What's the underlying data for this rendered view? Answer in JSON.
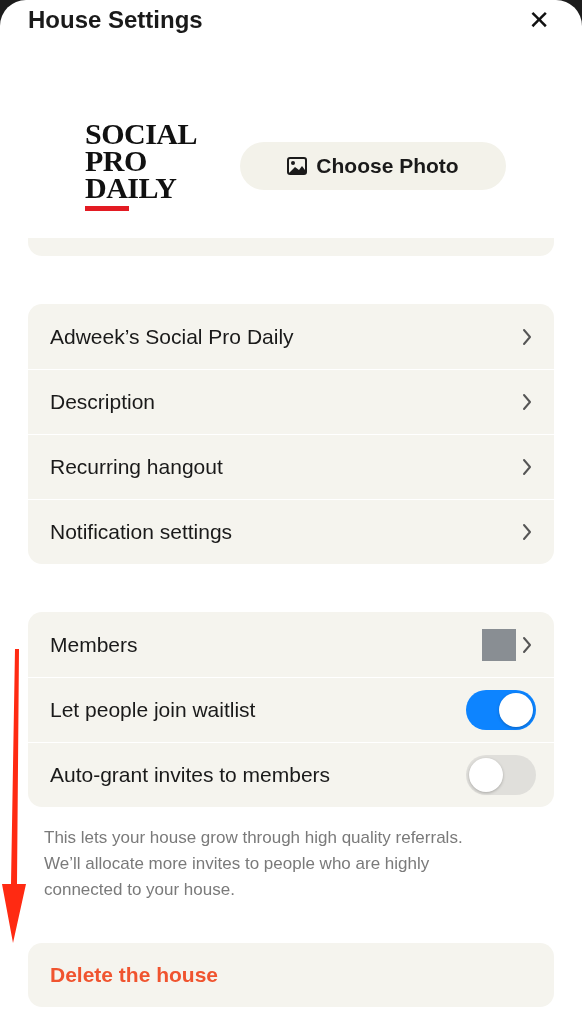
{
  "header": {
    "title": "House Settings",
    "close": "✕"
  },
  "logo": {
    "lines": [
      "SOCIAL",
      "PRO",
      "DAILY"
    ]
  },
  "choose_photo": {
    "label": "Choose Photo"
  },
  "settings": [
    {
      "label": "Adweek’s Social Pro Daily"
    },
    {
      "label": "Description"
    },
    {
      "label": "Recurring hangout"
    },
    {
      "label": "Notification settings"
    }
  ],
  "members_settings": [
    {
      "kind": "link",
      "label": "Members"
    },
    {
      "kind": "toggle",
      "label": "Let people join waitlist",
      "on": true
    },
    {
      "kind": "toggle",
      "label": "Auto-grant invites to members",
      "on": false
    }
  ],
  "footnote": "This lets your house grow through high quality referrals. We’ll allocate more invites to people who are highly connected to your house.",
  "delete_button": {
    "label": "Delete the house"
  }
}
